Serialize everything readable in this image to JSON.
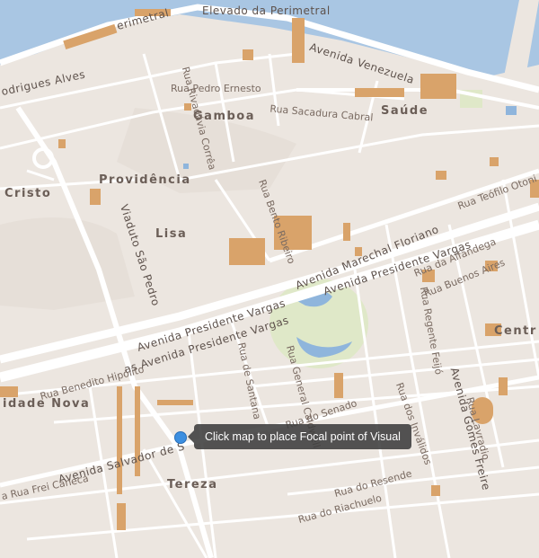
{
  "map": {
    "tooltip": "Click map to place Focal point of Visual",
    "colors": {
      "water": "#a9c6e3",
      "land": "#ece6e0",
      "road": "#ffffff",
      "building": "#d9a36a",
      "park": "#dfe8c8",
      "pond": "#8fb5dc"
    },
    "districts": {
      "gamboa": "Gamboa",
      "saude": "Saúde",
      "providencia": "Providência",
      "cristo": "Cristo",
      "lisa": "Lisa",
      "cidade_nova": "idade Nova",
      "tereza": "Tereza",
      "centro": "Centr"
    },
    "streets": {
      "elevado": "Elevado da Perimetral",
      "perimetral": "erimetral",
      "rodrigues": "odrigues Alves",
      "venezuela": "Avenida Venezuela",
      "pedro_ernesto": "Rua Pedro Ernesto",
      "sacadura": "Rua Sacadura Cabral",
      "rivadavia": "Rua Rivadávia Corrêa",
      "marechal": "Avenida Marechal Floriano",
      "teofilo": "Rua Teófilo Otoni",
      "pres_vargas_1": "Avenida Presidente Vargas",
      "pres_vargas_2": "Avenida Presidente Vargas",
      "pres_vargas_3": "as Avenida Presidente Vargas",
      "alfandega": "Rua da Alfândega",
      "buenos_aires": "Rua Buenos Aires",
      "bento_ribeiro": "Rua Bento Ribeiro",
      "viaduto": "Viaduto São Pedro",
      "benedito": "Rua Benedito Hipólito",
      "santana": "Rua de Santana",
      "caldwell": "Rua General Caldwell",
      "senado": "Rua do Senado",
      "invalidos": "Rua dos Inválidos",
      "regente": "Rua Regente Feijó",
      "gomes_freire": "Avenida Gomes Freire",
      "lavradio": "Rua Lavradio",
      "salvador": "Avenida Salvador de S",
      "frei_caneca": "a Rua Frei Caneca",
      "resende": "Rua do Resende",
      "riachuelo": "Rua do Riachuelo"
    }
  }
}
